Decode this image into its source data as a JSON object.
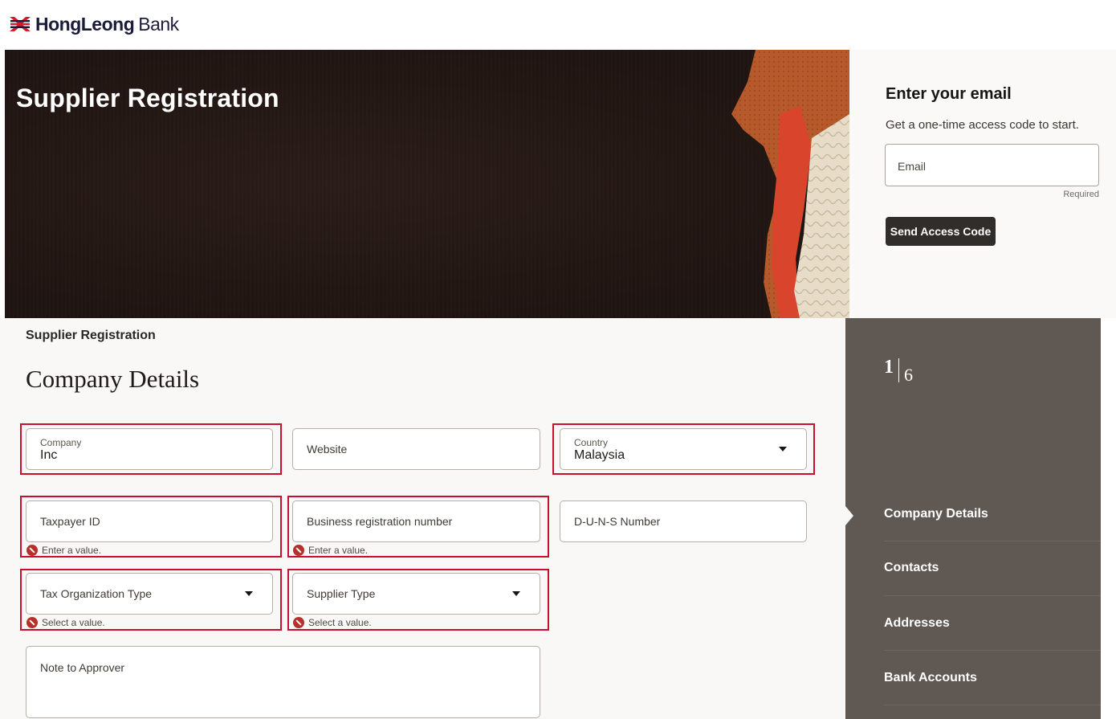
{
  "brand": {
    "name_bold": "HongLeong",
    "name_light": "Bank"
  },
  "hero": {
    "title": "Supplier Registration"
  },
  "email_panel": {
    "title": "Enter your email",
    "subtitle": "Get a one-time access code to start.",
    "email_label": "Email",
    "required_text": "Required",
    "send_button": "Send Access Code"
  },
  "form": {
    "breadcrumb": "Supplier Registration",
    "title": "Company Details",
    "company": {
      "label": "Company",
      "value": "Inc"
    },
    "website": {
      "label": "Website"
    },
    "country": {
      "label": "Country",
      "value": "Malaysia"
    },
    "taxpayer_id": {
      "label": "Taxpayer ID",
      "error": "Enter a value."
    },
    "business_reg": {
      "label": "Business registration number",
      "error": "Enter a value."
    },
    "duns": {
      "label": "D-U-N-S Number"
    },
    "tax_org_type": {
      "label": "Tax Organization Type",
      "error": "Select a value."
    },
    "supplier_type": {
      "label": "Supplier Type",
      "error": "Select a value."
    },
    "note": {
      "label": "Note to Approver"
    }
  },
  "steps": {
    "current": "1",
    "total": "6",
    "items": [
      {
        "label": "Company Details"
      },
      {
        "label": "Contacts"
      },
      {
        "label": "Addresses"
      },
      {
        "label": "Bank Accounts"
      }
    ]
  },
  "colors": {
    "highlight": "#c8102e",
    "sidebar": "#605852",
    "button": "#312d2a",
    "error_icon": "#b7312c"
  }
}
